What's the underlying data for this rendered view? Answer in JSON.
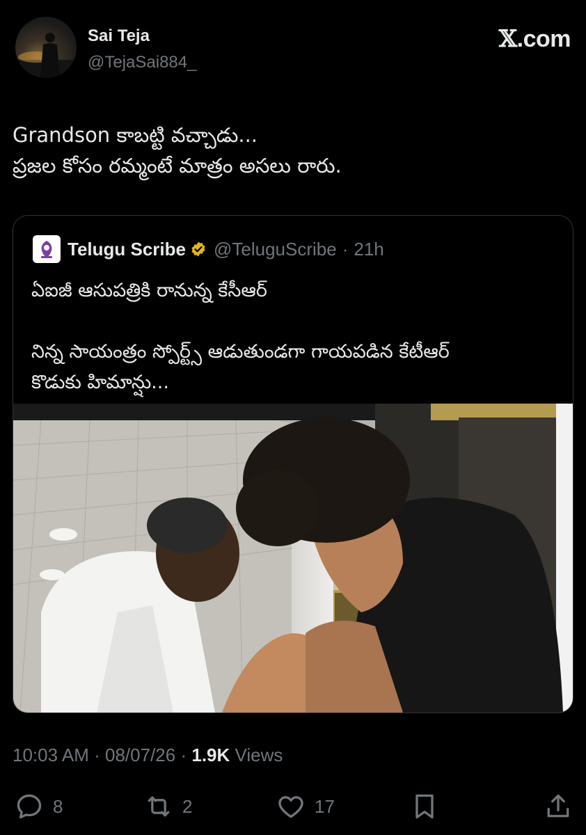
{
  "author": {
    "name": "Sai Teja",
    "handle": "@TejaSai884_"
  },
  "brand": {
    "site": ".com"
  },
  "tweet": {
    "lines": [
      "Grandson కాబట్టి వచ్చాడు...",
      "ప్రజల కోసం రమ్మంటే మాత్రం అసలు రారు."
    ]
  },
  "quote": {
    "name": "Telugu Scribe",
    "handle": "@TeluguScribe",
    "separator": "·",
    "time": "21h",
    "verified": true,
    "lines": [
      "ఏఐజీ ఆసుపత్రికి రానున్న కేసీఆర్",
      "",
      "నిన్న సాయంత్రం స్పోర్ట్స్ ఆడుతుండగా గాయపడిన కేటీఆర్",
      "కొడుకు హిమాన్షు..."
    ],
    "logo_color": "#7b3fa0"
  },
  "meta": {
    "time": "10:03 AM",
    "sep1": "·",
    "date": "08/07/26",
    "sep2": "·",
    "views_count": "1.9K",
    "views_label": "Views"
  },
  "actions": {
    "reply_count": "8",
    "retweet_count": "2",
    "like_count": "17",
    "reply_icon": "reply-icon",
    "retweet_icon": "retweet-icon",
    "like_icon": "heart-icon",
    "bookmark_icon": "bookmark-icon",
    "share_icon": "share-icon"
  },
  "colors": {
    "background": "#000000",
    "text": "#e7e9ea",
    "muted": "#71767b",
    "verified_gold": "#e2b719"
  }
}
